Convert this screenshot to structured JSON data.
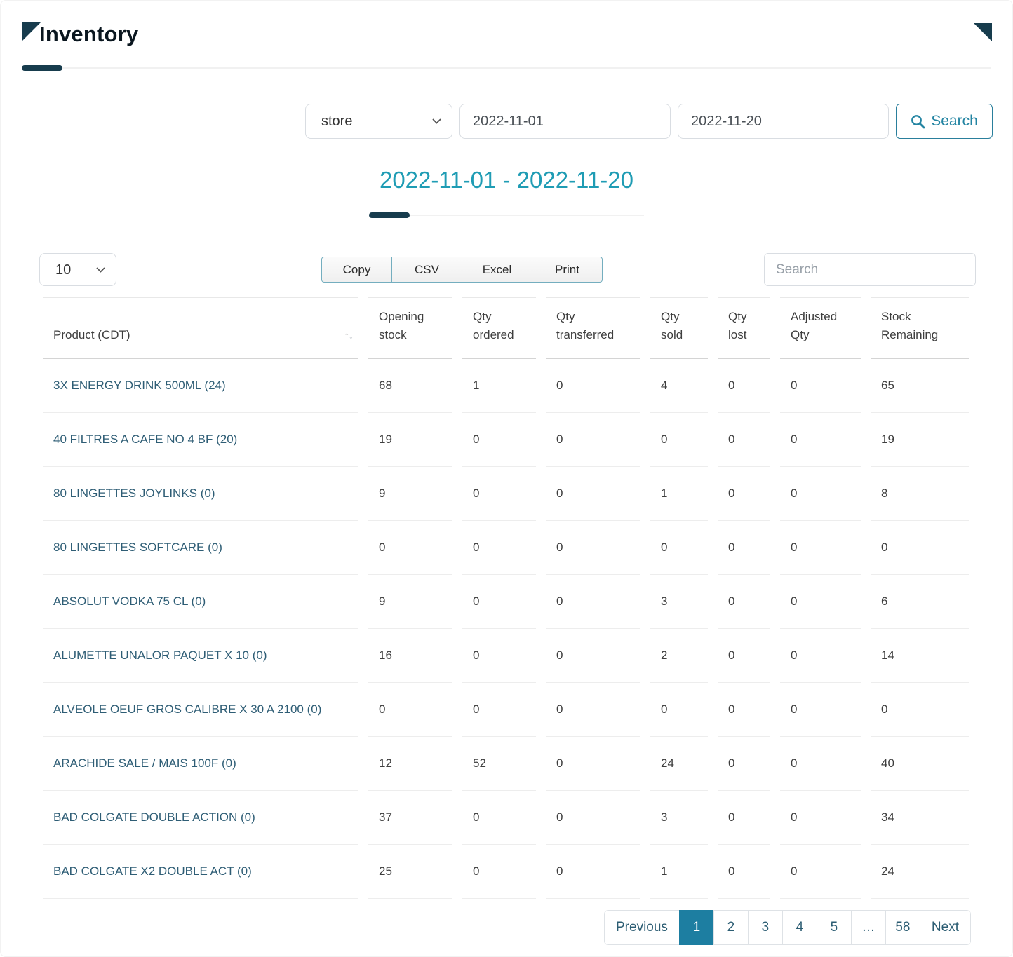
{
  "page": {
    "title": "Inventory"
  },
  "filters": {
    "store": "store",
    "date_from": "2022-11-01",
    "date_to": "2022-11-20",
    "search_label": "Search"
  },
  "heading": {
    "range": "2022-11-01 - 2022-11-20"
  },
  "toolbar": {
    "page_size": "10",
    "export_buttons": [
      "Copy",
      "CSV",
      "Excel",
      "Print"
    ],
    "search_placeholder": "Search"
  },
  "table": {
    "columns": [
      "Product (CDT)",
      "Opening\nstock",
      "Qty\nordered",
      "Qty\ntransferred",
      "Qty\nsold",
      "Qty\nlost",
      "Adjusted\nQty",
      "Stock\nRemaining"
    ],
    "sort_icon_up": "↑",
    "sort_icon_down": "↓",
    "rows": [
      {
        "product": "3X ENERGY DRINK 500ML (24)",
        "values": [
          "68",
          "1",
          "0",
          "4",
          "0",
          "0",
          "65"
        ]
      },
      {
        "product": "40 FILTRES A CAFE NO 4 BF (20)",
        "values": [
          "19",
          "0",
          "0",
          "0",
          "0",
          "0",
          "19"
        ]
      },
      {
        "product": "80 LINGETTES JOYLINKS (0)",
        "values": [
          "9",
          "0",
          "0",
          "1",
          "0",
          "0",
          "8"
        ]
      },
      {
        "product": "80 LINGETTES SOFTCARE (0)",
        "values": [
          "0",
          "0",
          "0",
          "0",
          "0",
          "0",
          "0"
        ]
      },
      {
        "product": "ABSOLUT VODKA 75 CL (0)",
        "values": [
          "9",
          "0",
          "0",
          "3",
          "0",
          "0",
          "6"
        ]
      },
      {
        "product": "ALUMETTE UNALOR PAQUET X 10 (0)",
        "values": [
          "16",
          "0",
          "0",
          "2",
          "0",
          "0",
          "14"
        ]
      },
      {
        "product": "ALVEOLE OEUF GROS CALIBRE X 30 A 2100 (0)",
        "values": [
          "0",
          "0",
          "0",
          "0",
          "0",
          "0",
          "0"
        ]
      },
      {
        "product": "ARACHIDE SALE / MAIS 100F (0)",
        "values": [
          "12",
          "52",
          "0",
          "24",
          "0",
          "0",
          "40"
        ]
      },
      {
        "product": "BAD COLGATE DOUBLE ACTION (0)",
        "values": [
          "37",
          "0",
          "0",
          "3",
          "0",
          "0",
          "34"
        ]
      },
      {
        "product": "BAD COLGATE X2 DOUBLE ACT (0)",
        "values": [
          "25",
          "0",
          "0",
          "1",
          "0",
          "0",
          "24"
        ]
      }
    ]
  },
  "pagination": {
    "previous": "Previous",
    "pages": [
      "1",
      "2",
      "3",
      "4",
      "5",
      "…",
      "58"
    ],
    "active_page": "1",
    "next": "Next"
  },
  "colors": {
    "accent_dark": "#173C4D",
    "teal_heading": "#1F9CB4",
    "search_button_teal": "#2384A2",
    "active_page_bg": "#1D7EA1",
    "product_link": "#2E5D75"
  }
}
